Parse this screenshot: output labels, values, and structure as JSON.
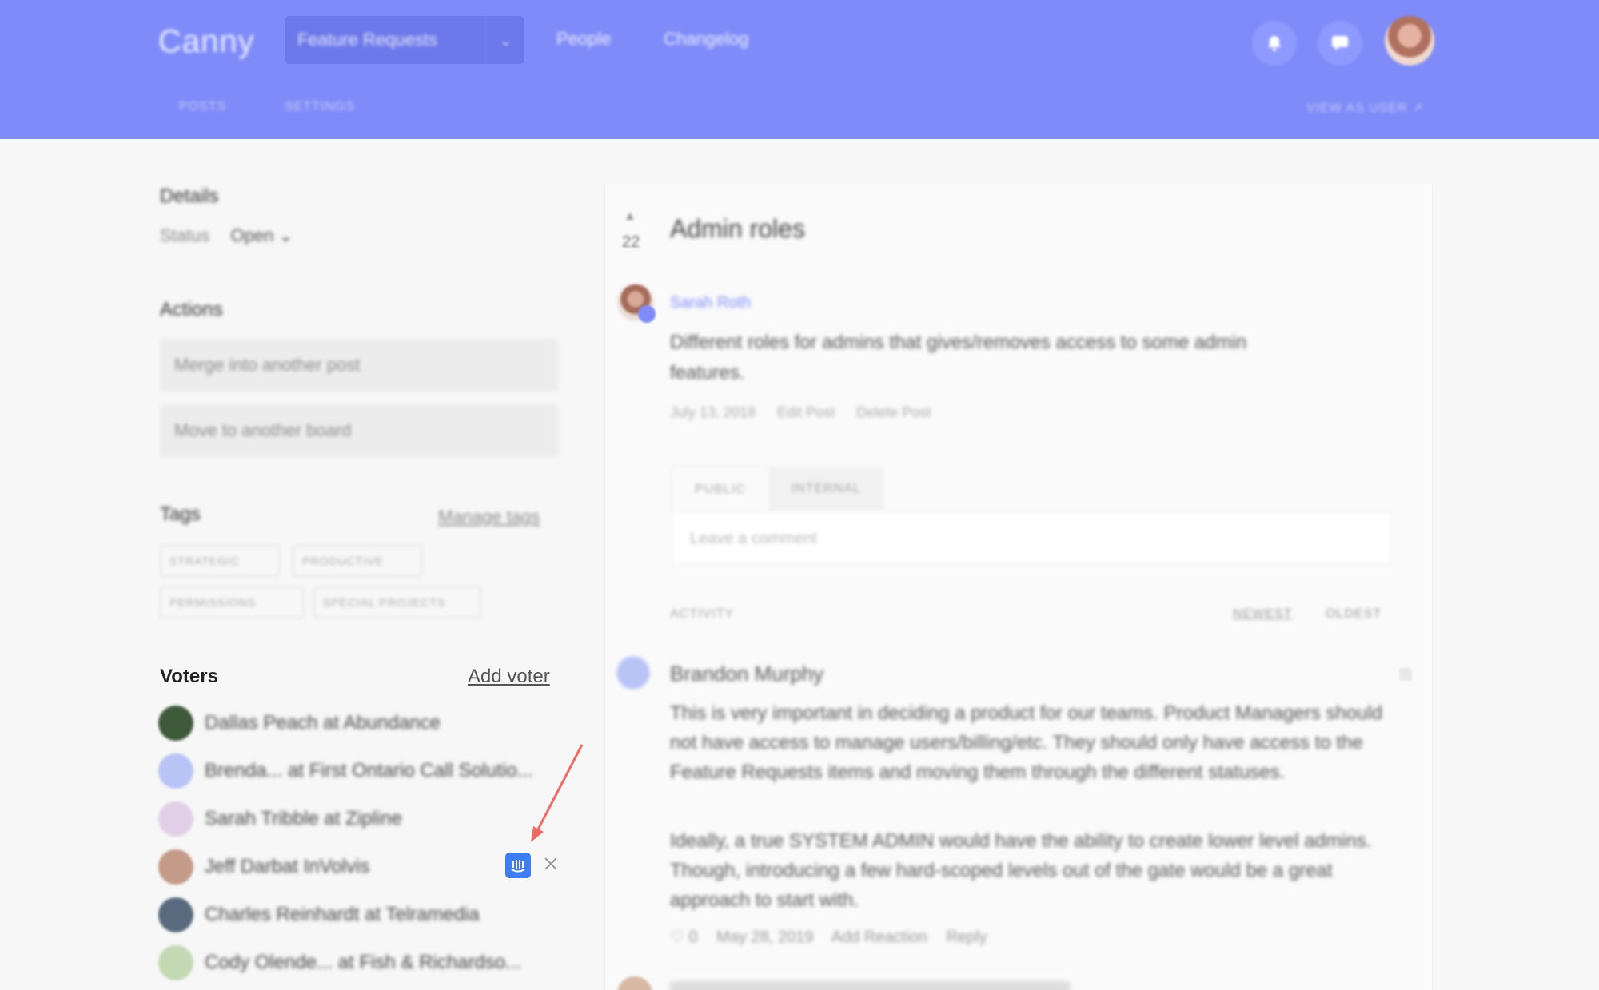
{
  "header": {
    "logo": "Canny",
    "board_selector": {
      "label": "Feature Requests",
      "chevron": "⌄"
    },
    "nav": [
      "People",
      "Changelog"
    ],
    "icons": [
      "notification-icon",
      "chat-icon"
    ],
    "sub_nav": [
      "POSTS",
      "SETTINGS"
    ],
    "view_link": "VIEW AS USER ↗"
  },
  "sidebar": {
    "details_title": "Details",
    "status_label": "Status",
    "status_value": "Open ⌄",
    "actions_title": "Actions",
    "actions": [
      "Merge into another post",
      "Move to another board"
    ],
    "tags_title": "Tags",
    "manage_tags": "Manage tags",
    "tags": [
      "STRATEGIC",
      "PRODUCTIVE",
      "PERMISSIONS",
      "SPECIAL PROJECTS"
    ],
    "voters_title": "Voters",
    "add_voter": "Add voter",
    "voters": [
      {
        "name": "Dallas Peach at Abundance",
        "avatar_color": "#3f5a3b"
      },
      {
        "name": "Brenda... at First Ontario Call Solutio...",
        "avatar_color": "#b8c3f6"
      },
      {
        "name": "Sarah Tribble at Zipline",
        "avatar_color": "#e0cfe6"
      },
      {
        "name": "Jeff Darbat InVolvis",
        "avatar_color": "#c49a88"
      },
      {
        "name": "Charles Reinhardt at Telramedia",
        "avatar_color": "#5a6a7e"
      },
      {
        "name": "Cody Olende... at Fish & Richardso...",
        "avatar_color": "#c3d9b3"
      }
    ]
  },
  "post": {
    "vote_arrow": "▲",
    "vote_count": "22",
    "title": "Admin roles",
    "author": "Sarah Roth",
    "body": "Different roles for admins that gives/removes access to some admin features.",
    "meta": [
      "July 13, 2018",
      "Edit Post",
      "Delete Post"
    ],
    "tabs": [
      "PUBLIC",
      "INTERNAL"
    ],
    "comment_placeholder": "Leave a comment",
    "activity_label": "ACTIVITY",
    "sort_options": [
      "NEWEST",
      "OLDEST"
    ]
  },
  "comment": {
    "author": "Brandon Murphy",
    "paragraphs": [
      "This is very important in deciding a product for our teams. Product Managers should not have access to manage users/billing/etc. They should only have access to the Feature Requests items and moving them through the different statuses.",
      "Ideally, a true SYSTEM ADMIN would have the ability to create lower level admins. Though, introducing a few hard-scoped levels out of the gate would be a great approach to start with."
    ],
    "meta": [
      "♡ 0",
      "May 28, 2019",
      "Add Reaction",
      "Reply"
    ]
  },
  "annotation": {
    "arrow_color": "#ee6a66"
  },
  "colors": {
    "brand": "#7f8bf8",
    "intercom": "#3e7ef2"
  }
}
